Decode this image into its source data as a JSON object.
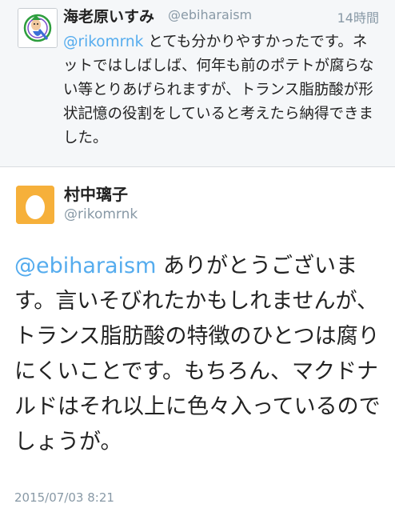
{
  "reply_tweet": {
    "display_name": "海老原いすみ",
    "handle": "@ebiharaism",
    "time": "14時間",
    "mention": "@rikomrnk",
    "text": " とても分かりやすかったです。ネットではしばしば、何年も前のポテトが腐らない等とりあげられますが、トランス脂肪酸が形状記憶の役割をしていると考えたら納得できました。",
    "avatar_icon": "cartoon-character-icon"
  },
  "main_tweet": {
    "display_name": "村中璃子",
    "handle": "@rikomrnk",
    "mention": "@ebiharaism",
    "text": " ありがとうございます。言いそびれたかもしれませんが、トランス脂肪酸の特徴のひとつは腐りにくいことです。もちろん、マクドナルドはそれ以上に色々入っているのでしょうが。",
    "date": "2015/07/03 8:21",
    "avatar_icon": "default-egg-icon",
    "avatar_color": "#f6b03a"
  },
  "colors": {
    "link": "#55acee",
    "meta": "#8899a6",
    "reply_background": "#f5f7f9"
  }
}
